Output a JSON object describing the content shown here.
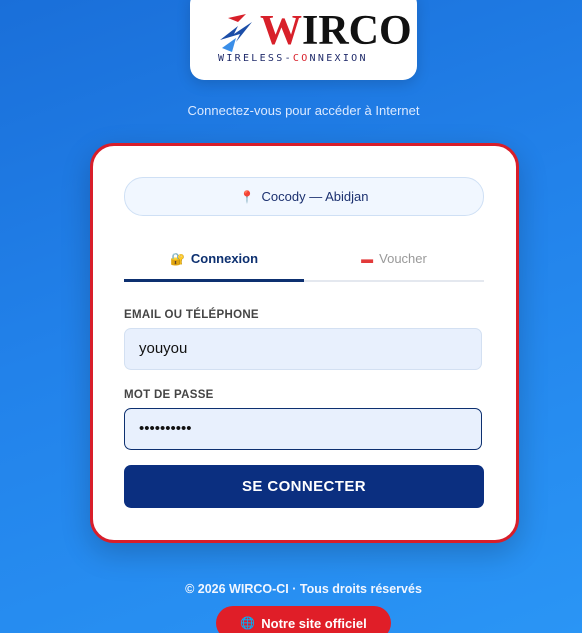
{
  "brand": {
    "wordmark_first": "W",
    "wordmark_rest": "IRCO",
    "subtitle_part1": "WIRELESS-",
    "subtitle_accent": "CO",
    "subtitle_part2": "NNEXION"
  },
  "tagline": "Connectez-vous pour accéder à Internet",
  "location": {
    "label": "Cocody — Abidjan",
    "icon": "pin-icon"
  },
  "tabs": [
    {
      "label": "Connexion",
      "icon": "lock-icon",
      "active": true
    },
    {
      "label": "Voucher",
      "icon": "ticket-icon",
      "active": false
    }
  ],
  "form": {
    "email_label": "EMAIL OU TÉLÉPHONE",
    "email_value": "youyou",
    "password_label": "MOT DE PASSE",
    "password_value": "••••••••••",
    "submit_label": "SE CONNECTER"
  },
  "footer": {
    "copyright": "© 2026 WIRCO-CI · Tous droits réservés",
    "official_link": "Notre site officiel"
  },
  "colors": {
    "primary": "#0b2f80",
    "accent": "#d81e2a",
    "background": "#2282ea"
  }
}
